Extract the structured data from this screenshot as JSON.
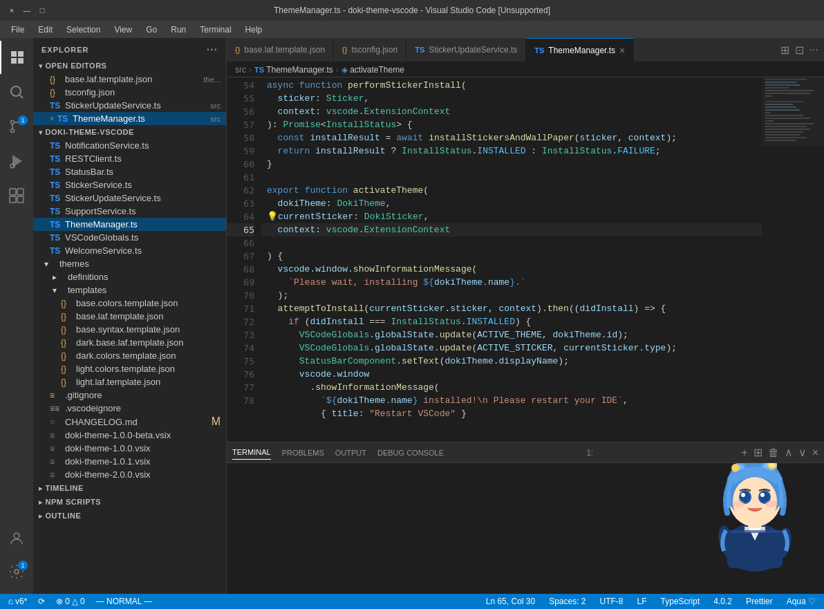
{
  "titleBar": {
    "title": "ThemeManager.ts - doki-theme-vscode - Visual Studio Code [Unsupported]",
    "controls": [
      "×",
      "—",
      "□"
    ]
  },
  "menuBar": {
    "items": [
      "File",
      "Edit",
      "Selection",
      "View",
      "Go",
      "Run",
      "Terminal",
      "Help"
    ]
  },
  "activityBar": {
    "icons": [
      {
        "name": "explorer-icon",
        "label": "Explorer",
        "active": true,
        "symbol": "⎗"
      },
      {
        "name": "search-icon",
        "label": "Search",
        "symbol": "🔍"
      },
      {
        "name": "source-control-icon",
        "label": "Source Control",
        "symbol": "⑂",
        "badge": "1"
      },
      {
        "name": "run-icon",
        "label": "Run and Debug",
        "symbol": "▷"
      },
      {
        "name": "extensions-icon",
        "label": "Extensions",
        "symbol": "⊞"
      }
    ],
    "bottomIcons": [
      {
        "name": "accounts-icon",
        "label": "Accounts",
        "symbol": "👤"
      },
      {
        "name": "settings-icon",
        "label": "Settings",
        "symbol": "⚙",
        "badge": "1"
      }
    ]
  },
  "sidebar": {
    "title": "EXPLORER",
    "sections": {
      "openEditors": {
        "label": "OPEN EDITORS",
        "expanded": true,
        "files": [
          {
            "icon": "json",
            "name": "base.laf.template.json",
            "extra": "the...",
            "indent": 1
          },
          {
            "icon": "json",
            "name": "tsconfig.json",
            "indent": 1
          },
          {
            "icon": "ts",
            "name": "StickerUpdateService.ts",
            "extra": "src",
            "indent": 1
          },
          {
            "icon": "ts",
            "name": "ThemeManager.ts",
            "extra": "src",
            "indent": 1,
            "close": true,
            "active": true
          }
        ]
      },
      "project": {
        "label": "DOKI-THEME-VSCODE",
        "expanded": true,
        "items": [
          {
            "type": "file",
            "icon": "ts",
            "name": "NotificationService.ts",
            "indent": 1
          },
          {
            "type": "file",
            "icon": "ts",
            "name": "RESTClient.ts",
            "indent": 1
          },
          {
            "type": "file",
            "icon": "ts",
            "name": "StatusBar.ts",
            "indent": 1
          },
          {
            "type": "file",
            "icon": "ts",
            "name": "StickerService.ts",
            "indent": 1
          },
          {
            "type": "file",
            "icon": "ts",
            "name": "StickerUpdateService.ts",
            "indent": 1
          },
          {
            "type": "file",
            "icon": "ts",
            "name": "SupportService.ts",
            "indent": 1
          },
          {
            "type": "file",
            "icon": "ts",
            "name": "ThemeManager.ts",
            "indent": 1,
            "active": true
          },
          {
            "type": "file",
            "icon": "ts",
            "name": "VSCodeGlobals.ts",
            "indent": 1
          },
          {
            "type": "file",
            "icon": "ts",
            "name": "WelcomeService.ts",
            "indent": 1
          },
          {
            "type": "folder",
            "name": "themes",
            "indent": 1,
            "expanded": true
          },
          {
            "type": "folder",
            "name": "definitions",
            "indent": 2,
            "expanded": false
          },
          {
            "type": "folder",
            "name": "templates",
            "indent": 2,
            "expanded": true
          },
          {
            "type": "file",
            "icon": "json",
            "name": "base.colors.template.json",
            "indent": 3
          },
          {
            "type": "file",
            "icon": "json",
            "name": "base.laf.template.json",
            "indent": 3
          },
          {
            "type": "file",
            "icon": "json",
            "name": "base.syntax.template.json",
            "indent": 3
          },
          {
            "type": "file",
            "icon": "json",
            "name": "dark.base.laf.template.json",
            "indent": 3
          },
          {
            "type": "file",
            "icon": "json",
            "name": "dark.colors.template.json",
            "indent": 3
          },
          {
            "type": "file",
            "icon": "json",
            "name": "light.colors.template.json",
            "indent": 3
          },
          {
            "type": "file",
            "icon": "json",
            "name": "light.laf.template.json",
            "indent": 3
          },
          {
            "type": "file",
            "icon": "git",
            "name": ".gitignore",
            "indent": 1
          },
          {
            "type": "file",
            "icon": "git",
            "name": ".vscodeignore",
            "indent": 1
          },
          {
            "type": "file",
            "icon": "md",
            "name": "CHANGELOG.md",
            "indent": 1,
            "modified": true
          },
          {
            "type": "file",
            "icon": "vsix",
            "name": "doki-theme-1.0.0-beta.vsix",
            "indent": 1
          },
          {
            "type": "file",
            "icon": "vsix",
            "name": "doki-theme-1.0.0.vsix",
            "indent": 1
          },
          {
            "type": "file",
            "icon": "vsix",
            "name": "doki-theme-1.0.1.vsix",
            "indent": 1
          },
          {
            "type": "file",
            "icon": "vsix",
            "name": "doki-theme-2.0.0.vsix",
            "indent": 1
          }
        ]
      },
      "timeline": {
        "label": "TIMELINE",
        "expanded": false
      },
      "npmScripts": {
        "label": "NPM SCRIPTS",
        "expanded": false
      },
      "outline": {
        "label": "OUTLINE",
        "expanded": false
      }
    }
  },
  "tabs": [
    {
      "icon": "json",
      "name": "base.laf.template.json",
      "active": false
    },
    {
      "icon": "json",
      "name": "tsconfig.json",
      "active": false
    },
    {
      "icon": "ts",
      "name": "StickerUpdateService.ts",
      "active": false
    },
    {
      "icon": "ts",
      "name": "ThemeManager.ts",
      "active": true,
      "close": true
    }
  ],
  "breadcrumb": {
    "parts": [
      "src",
      "TS ThemeManager.ts",
      "activateTheme"
    ]
  },
  "code": {
    "startLine": 54,
    "lines": [
      {
        "num": 54,
        "text": "async function performStickerInstall(",
        "tokens": [
          {
            "t": "kw",
            "v": "async"
          },
          {
            "t": "",
            "v": " "
          },
          {
            "t": "kw",
            "v": "function"
          },
          {
            "t": "",
            "v": " "
          },
          {
            "t": "fn",
            "v": "performStickerInstall"
          },
          {
            "t": "",
            "v": "("
          }
        ]
      },
      {
        "num": 55,
        "text": "  sticker: Sticker,"
      },
      {
        "num": 56,
        "text": "  context: vscode.ExtensionContext"
      },
      {
        "num": 57,
        "text": "): Promise<InstallStatus> {"
      },
      {
        "num": 58,
        "text": "  const installResult = await installStickersAndWallPaper(sticker, context);"
      },
      {
        "num": 59,
        "text": "  return installResult ? InstallStatus.INSTALLED : InstallStatus.FAILURE;"
      },
      {
        "num": 60,
        "text": "}"
      },
      {
        "num": 61,
        "text": ""
      },
      {
        "num": 62,
        "text": "export function activateTheme("
      },
      {
        "num": 63,
        "text": "  dokiTheme: DokiTheme,"
      },
      {
        "num": 64,
        "text": "  💡currentSticker: DokiSticker,",
        "lightbulb": true
      },
      {
        "num": 65,
        "text": "  context: vscode.ExtensionContext",
        "highlight": true
      },
      {
        "num": 66,
        "text": ") {"
      },
      {
        "num": 67,
        "text": "  vscode.window.showInformationMessage("
      },
      {
        "num": 68,
        "text": "    `Please wait, installing ${dokiTheme.name}.`"
      },
      {
        "num": 69,
        "text": "  );"
      },
      {
        "num": 70,
        "text": "  attemptToInstall(currentSticker.sticker, context).then((didInstall) => {"
      },
      {
        "num": 71,
        "text": "    if (didInstall === InstallStatus.INSTALLED) {"
      },
      {
        "num": 72,
        "text": "      VSCodeGlobals.globalState.update(ACTIVE_THEME, dokiTheme.id);"
      },
      {
        "num": 73,
        "text": "      VSCodeGlobals.globalState.update(ACTIVE_STICKER, currentSticker.type);"
      },
      {
        "num": 74,
        "text": "      StatusBarComponent.setText(dokiTheme.displayName);"
      },
      {
        "num": 75,
        "text": "      vscode.window"
      },
      {
        "num": 76,
        "text": "        .showInformationMessage("
      },
      {
        "num": 77,
        "text": "          `${dokiTheme.name} installed!\\n Please restart your IDE`,"
      },
      {
        "num": 78,
        "text": "          { title: \"Restart VSCode\" }"
      }
    ]
  },
  "terminal": {
    "tabs": [
      "TERMINAL",
      "PROBLEMS",
      "OUTPUT",
      "DEBUG CONSOLE"
    ],
    "activeTab": "TERMINAL",
    "lineInfo": "1:"
  },
  "statusBar": {
    "left": [
      {
        "text": "⎌ v6*",
        "name": "branch"
      },
      {
        "text": "⟳",
        "name": "sync"
      },
      {
        "text": "⊗ 0  △ 0",
        "name": "errors"
      },
      {
        "text": "— NORMAL —",
        "name": "vim-mode"
      }
    ],
    "right": [
      {
        "text": "Ln 65, Col 30",
        "name": "cursor-pos"
      },
      {
        "text": "Spaces: 2",
        "name": "indent"
      },
      {
        "text": "UTF-8",
        "name": "encoding"
      },
      {
        "text": "LF",
        "name": "eol"
      },
      {
        "text": "TypeScript",
        "name": "language"
      },
      {
        "text": "4.0.2",
        "name": "ts-version"
      },
      {
        "text": "Prettier",
        "name": "formatter"
      },
      {
        "text": "Aqua ♡",
        "name": "theme"
      }
    ]
  }
}
